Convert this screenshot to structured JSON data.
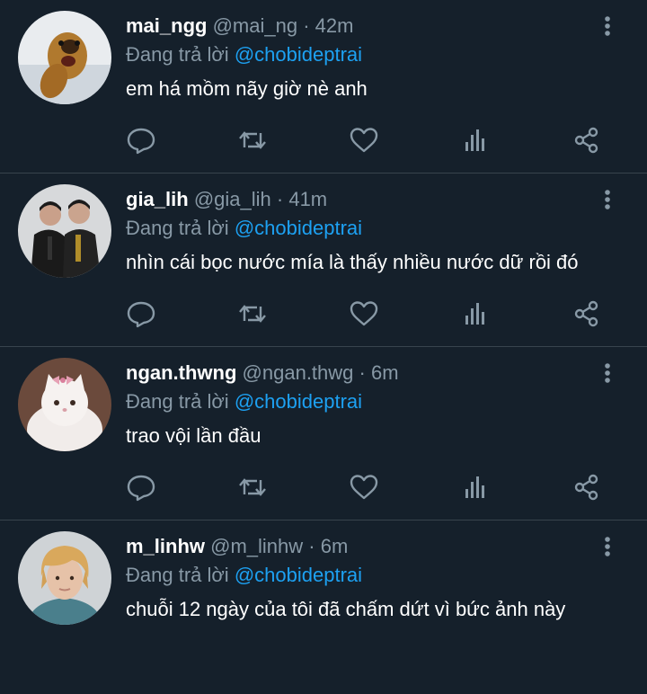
{
  "colors": {
    "background": "#15202b",
    "text": "#ffffff",
    "muted": "#8899a6",
    "accent": "#1da1f2",
    "divider": "#38444d"
  },
  "replies": [
    {
      "name": "mai_ngg",
      "handle": "@mai_ng",
      "dot": "·",
      "time": "42m",
      "reply_prefix": "Đang trả lời",
      "mention": "@chobideptrai",
      "text": "em há mồm nãy giờ nè anh",
      "avatar": "dog-photo"
    },
    {
      "name": "gia_lih",
      "handle": "@gia_lih",
      "dot": "·",
      "time": "41m",
      "reply_prefix": "Đang trả lời",
      "mention": "@chobideptrai",
      "text": "nhìn cái bọc nước mía là thấy nhiều nước dữ rồi đó",
      "avatar": "two-men-photo"
    },
    {
      "name": "ngan.thwng",
      "handle": "@ngan.thwg",
      "dot": "·",
      "time": "6m",
      "reply_prefix": "Đang trả lời",
      "mention": "@chobideptrai",
      "text": "trao vội lần đầu",
      "avatar": "white-cat-photo"
    },
    {
      "name": "m_linhw",
      "handle": "@m_linhw",
      "dot": "·",
      "time": "6m",
      "reply_prefix": "Đang trả lời",
      "mention": "@chobideptrai",
      "text": "chuỗi 12 ngày của tôi đã chấm dứt vì bức ảnh này",
      "avatar": "blonde-person-photo"
    }
  ]
}
